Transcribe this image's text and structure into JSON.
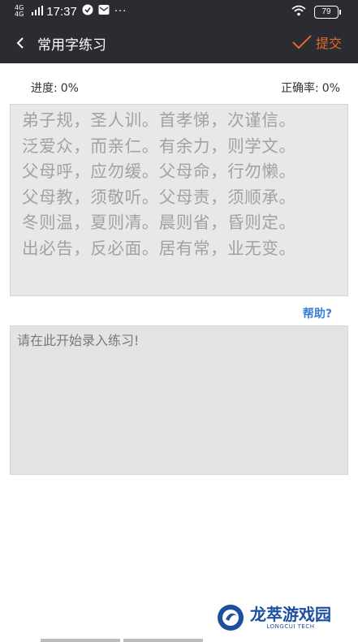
{
  "status_bar": {
    "network": "4G",
    "network2": "4G",
    "time": "17:37",
    "more": "···",
    "battery": "79"
  },
  "app_bar": {
    "title": "常用字练习",
    "submit_label": "提交",
    "accent_color": "#e4682b"
  },
  "stats": {
    "progress_label": "进度:",
    "progress_value": "0%",
    "accuracy_label": "正确率:",
    "accuracy_value": "0%"
  },
  "source_text": {
    "lines": [
      "弟子规，圣人训。首孝悌，次谨信。",
      "泛爱众，而亲仁。有余力，则学文。",
      "父母呼，应勿缓。父母命，行勿懒。",
      "父母教，须敬听。父母责，须顺承。",
      "冬则温，夏则凊。晨则省，昏则定。",
      "出必告，反必面。居有常，业无变。"
    ]
  },
  "help": {
    "label": "帮助?"
  },
  "input": {
    "placeholder": "请在此开始录入练习!",
    "value": ""
  },
  "watermark": {
    "name": "龙萃游戏园",
    "sub": "LONGCUI TECH"
  }
}
